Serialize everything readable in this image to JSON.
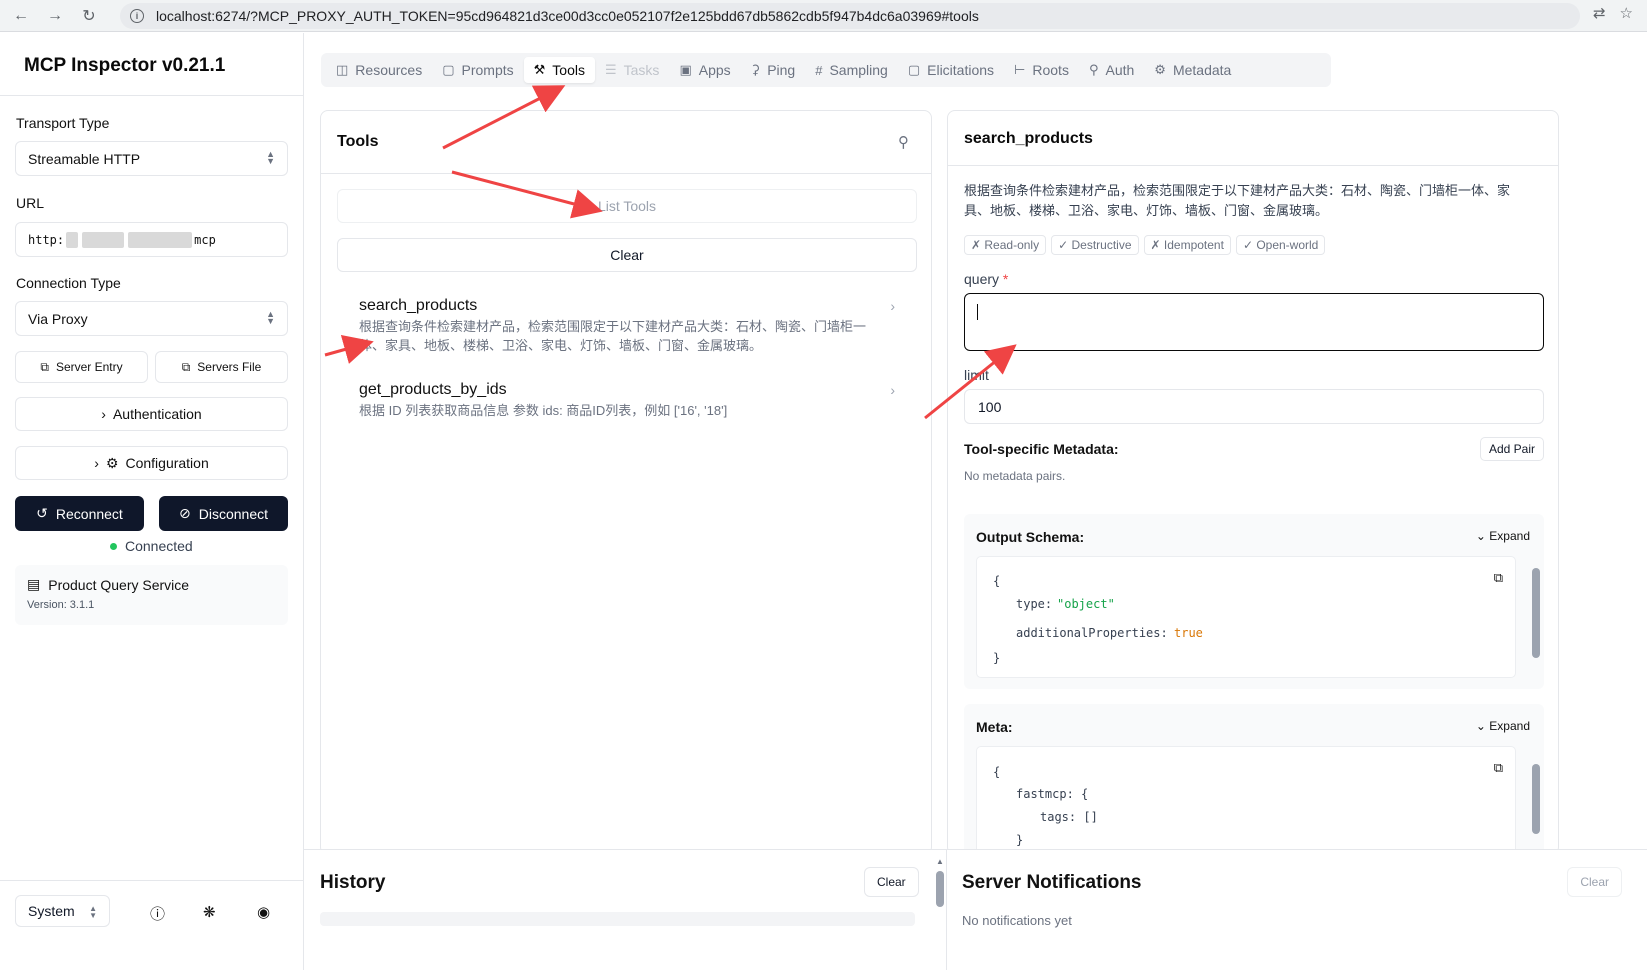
{
  "browser": {
    "url": "localhost:6274/?MCP_PROXY_AUTH_TOKEN=95cd964821d3ce00d3cc0e052107f2e125bdd67db5862cdb5f947b4dc6a03969#tools"
  },
  "sidebar": {
    "app_title": "MCP Inspector v0.21.1",
    "transport_label": "Transport Type",
    "transport_value": "Streamable HTTP",
    "url_label": "URL",
    "url_prefix": "http:",
    "url_suffix": "mcp",
    "connection_label": "Connection Type",
    "connection_value": "Via Proxy",
    "server_entry_label": "Server Entry",
    "servers_file_label": "Servers File",
    "authentication_label": "Authentication",
    "configuration_label": "Configuration",
    "reconnect_label": "Reconnect",
    "disconnect_label": "Disconnect",
    "status_text": "Connected",
    "server_name": "Product Query Service",
    "server_version": "Version: 3.1.1",
    "theme_value": "System"
  },
  "tabs": [
    {
      "label": "Resources",
      "icon": "file-icon",
      "state": "normal"
    },
    {
      "label": "Prompts",
      "icon": "message-icon",
      "state": "normal"
    },
    {
      "label": "Tools",
      "icon": "hammer-icon",
      "state": "active"
    },
    {
      "label": "Tasks",
      "icon": "list-icon",
      "state": "disabled"
    },
    {
      "label": "Apps",
      "icon": "window-icon",
      "state": "normal"
    },
    {
      "label": "Ping",
      "icon": "bell-icon",
      "state": "normal"
    },
    {
      "label": "Sampling",
      "icon": "hash-icon",
      "state": "normal"
    },
    {
      "label": "Elicitations",
      "icon": "message-icon",
      "state": "normal"
    },
    {
      "label": "Roots",
      "icon": "folder-tree-icon",
      "state": "normal"
    },
    {
      "label": "Auth",
      "icon": "key-icon",
      "state": "normal"
    },
    {
      "label": "Metadata",
      "icon": "gear-icon",
      "state": "normal"
    }
  ],
  "tools_panel": {
    "title": "Tools",
    "list_tools_label": "List Tools",
    "clear_label": "Clear",
    "tools": [
      {
        "name": "search_products",
        "description": "根据查询条件检索建材产品，检索范围限定于以下建材产品大类：石材、陶瓷、门墙柜一体、家具、地板、楼梯、卫浴、家电、灯饰、墙板、门窗、金属玻璃。"
      },
      {
        "name": "get_products_by_ids",
        "description": "根据 ID 列表获取商品信息 参数 ids: 商品ID列表，例如 ['16', '18']"
      }
    ]
  },
  "detail_panel": {
    "title": "search_products",
    "description": "根据查询条件检索建材产品，检索范围限定于以下建材产品大类：石材、陶瓷、门墙柜一体、家具、地板、楼梯、卫浴、家电、灯饰、墙板、门窗、金属玻璃。",
    "badges": [
      "✗ Read-only",
      "✓ Destructive",
      "✗ Idempotent",
      "✓ Open-world"
    ],
    "query_label": "query",
    "query_required_mark": "*",
    "query_value": "",
    "limit_label": "limit",
    "limit_value": "100",
    "metadata_title": "Tool-specific Metadata:",
    "add_pair_label": "Add Pair",
    "no_metadata_text": "No metadata pairs.",
    "output_schema": {
      "title": "Output Schema:",
      "expand_label": "Expand",
      "open_brace": "{",
      "type_key": "type:",
      "type_value": "\"object\"",
      "additional_key": "additionalProperties:",
      "additional_value": "true",
      "close_brace": "}"
    },
    "meta": {
      "title": "Meta:",
      "expand_label": "Expand",
      "open_brace": "{",
      "fastmcp_key": "fastmcp: {",
      "tags_line": "tags: []",
      "close_inner": "}"
    }
  },
  "history": {
    "title": "History",
    "clear_label": "Clear"
  },
  "notifications": {
    "title": "Server Notifications",
    "clear_label": "Clear",
    "empty_text": "No notifications yet"
  },
  "colors": {
    "accent_dark": "#0f172a",
    "connected": "#22c55e",
    "annotation_arrow": "#ef4444",
    "json_string": "#16a34a",
    "json_bool": "#d97706"
  }
}
